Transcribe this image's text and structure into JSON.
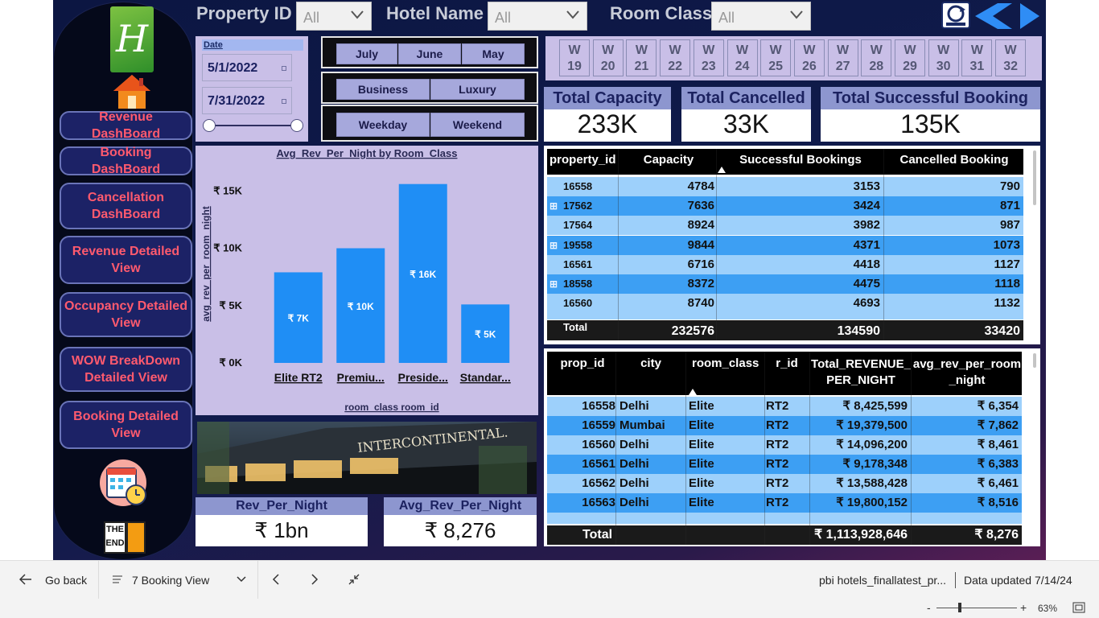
{
  "filters": {
    "property_label": "Property ID",
    "property_value": "All",
    "hotel_label": "Hotel Name",
    "hotel_value": "All",
    "room_label": "Room Class",
    "room_value": "All"
  },
  "sidebar": {
    "logo_letter": "H",
    "buttons": [
      "Revenue DashBoard",
      "Booking DashBoard",
      "Cancellation DashBoard",
      "Revenue Detailed View",
      "Occupancy Detailed View",
      "WOW BreakDown Detailed View",
      "Booking Detailed View"
    ],
    "end_text_1": "THE",
    "end_text_2": "END"
  },
  "date": {
    "label": "Date",
    "start": "5/1/2022",
    "end": "7/31/2022"
  },
  "slicers": {
    "months": [
      "July",
      "June",
      "May"
    ],
    "types": [
      "Business",
      "Luxury"
    ],
    "days": [
      "Weekday",
      "Weekend"
    ]
  },
  "weeks": [
    "19",
    "20",
    "21",
    "22",
    "23",
    "24",
    "25",
    "26",
    "27",
    "28",
    "29",
    "30",
    "31",
    "32"
  ],
  "week_prefix": "W",
  "kpis": {
    "capacity_label": "Total Capacity",
    "capacity_value": "233K",
    "cancelled_label": "Total Cancelled",
    "cancelled_value": "33K",
    "successful_label": "Total Successful Booking",
    "successful_value": "135K",
    "rev_label": "Rev_Per_Night",
    "rev_value": "₹ 1bn",
    "avg_rev_label": "Avg_Rev_Per_Night",
    "avg_rev_value": "₹ 8,276"
  },
  "chart_data": {
    "type": "bar",
    "title": "Avg_Rev_Per_Night by Room_Class",
    "xlabel": "room_class room_id",
    "ylabel": "avg_rev_per_room_night",
    "categories": [
      "Elite RT2",
      "Premiu...",
      "Preside...",
      "Standar..."
    ],
    "values": [
      7900,
      10000,
      15600,
      5100
    ],
    "data_labels": [
      "₹ 7K",
      "₹ 10K",
      "₹ 16K",
      "₹ 5K"
    ],
    "yticks": [
      "₹ 0K",
      "₹ 5K",
      "₹ 10K",
      "₹ 15K"
    ],
    "ylim": [
      0,
      16000
    ],
    "bar_color": "#1f8ef5"
  },
  "table1": {
    "headers": [
      "property_id",
      "Capacity",
      "Successful Bookings",
      "Cancelled Booking"
    ],
    "rows": [
      [
        "16558",
        "4784",
        "3153",
        "790"
      ],
      [
        "17562",
        "7636",
        "3424",
        "871"
      ],
      [
        "17564",
        "8924",
        "3982",
        "987"
      ],
      [
        "19558",
        "9844",
        "4371",
        "1073"
      ],
      [
        "16561",
        "6716",
        "4418",
        "1127"
      ],
      [
        "18558",
        "8372",
        "4475",
        "1118"
      ],
      [
        "16560",
        "8740",
        "4693",
        "1132"
      ]
    ],
    "total_label": "Total",
    "totals": [
      "232576",
      "134590",
      "33420"
    ]
  },
  "table2": {
    "headers": [
      "prop_id",
      "city",
      "room_class",
      "r_id",
      "Total_REVENUE_ PER_NIGHT",
      "avg_rev_per_room _night"
    ],
    "rows": [
      [
        "16558",
        "Delhi",
        "Elite",
        "RT2",
        "₹ 8,425,599",
        "₹ 6,354"
      ],
      [
        "16559",
        "Mumbai",
        "Elite",
        "RT2",
        "₹ 19,379,500",
        "₹ 7,862"
      ],
      [
        "16560",
        "Delhi",
        "Elite",
        "RT2",
        "₹ 14,096,200",
        "₹ 8,461"
      ],
      [
        "16561",
        "Delhi",
        "Elite",
        "RT2",
        "₹ 9,178,348",
        "₹ 6,383"
      ],
      [
        "16562",
        "Delhi",
        "Elite",
        "RT2",
        "₹ 13,588,428",
        "₹ 6,461"
      ],
      [
        "16563",
        "Delhi",
        "Elite",
        "RT2",
        "₹ 19,800,152",
        "₹ 8,516"
      ]
    ],
    "total_label": "Total",
    "totals": [
      "₹ 1,113,928,646",
      "₹ 8,276"
    ]
  },
  "hotel_sign": "INTERCONTINENTAL.",
  "bottom": {
    "go_back": "Go back",
    "page_name": "7 Booking View",
    "file_name": "pbi hotels_finallatest_pr...",
    "data_updated": "Data updated 7/14/24",
    "zoom": "63%"
  }
}
